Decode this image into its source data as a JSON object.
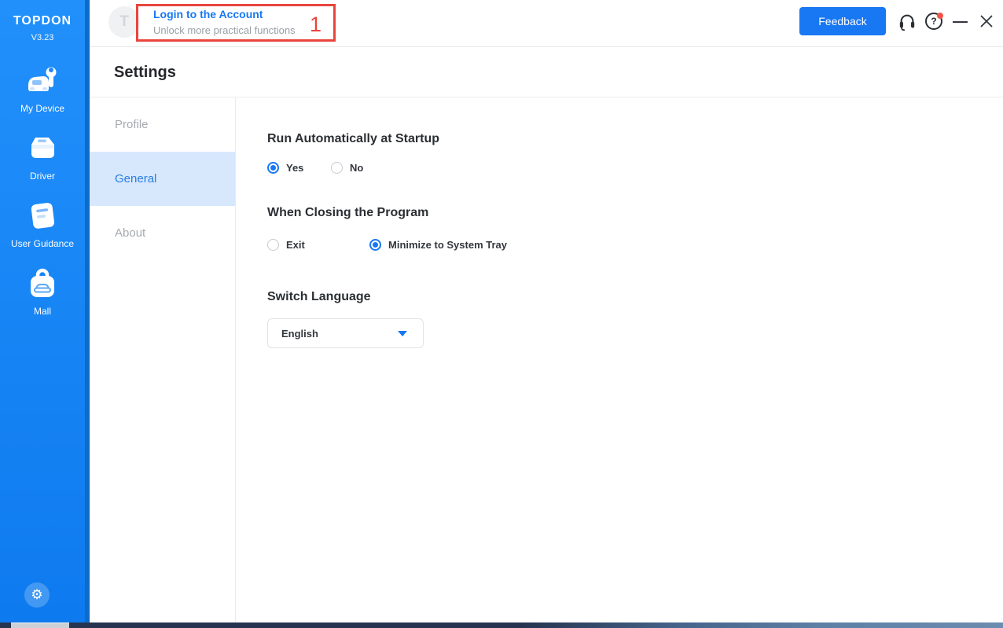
{
  "sidebar": {
    "brand": "TOPDON",
    "version": "V3.23",
    "items": [
      {
        "label": "My Device",
        "icon": "my-device-icon"
      },
      {
        "label": "Driver",
        "icon": "driver-icon"
      },
      {
        "label": "User Guidance",
        "icon": "user-guidance-icon"
      },
      {
        "label": "Mall",
        "icon": "mall-icon"
      }
    ]
  },
  "header": {
    "avatar_letter": "T",
    "login": {
      "title": "Login to the Account",
      "subtitle": "Unlock more practical functions"
    },
    "annotation_number": "1",
    "feedback_label": "Feedback",
    "help_glyph": "?"
  },
  "settings": {
    "title": "Settings",
    "nav": [
      {
        "label": "Profile",
        "active": false
      },
      {
        "label": "General",
        "active": true
      },
      {
        "label": "About",
        "active": false
      }
    ],
    "sections": [
      {
        "heading": "Run Automatically at Startup",
        "options": [
          {
            "label": "Yes",
            "selected": true
          },
          {
            "label": "No",
            "selected": false
          }
        ]
      },
      {
        "heading": "When Closing the Program",
        "options": [
          {
            "label": "Exit",
            "selected": false
          },
          {
            "label": "Minimize to System Tray",
            "selected": true
          }
        ]
      }
    ],
    "language": {
      "heading": "Switch Language",
      "selected": "English"
    }
  },
  "icons": {
    "gear_glyph": "⚙"
  },
  "colors": {
    "accent_blue": "#1778F2",
    "sidebar_blue": "#1987F9",
    "sidebar_edge_blue": "#0D6CC9",
    "active_nav_bg": "#D7E8FC",
    "active_nav_text": "#2A7DE1",
    "annotation_red": "#E8453C",
    "muted_text": "#A6AAAF"
  }
}
